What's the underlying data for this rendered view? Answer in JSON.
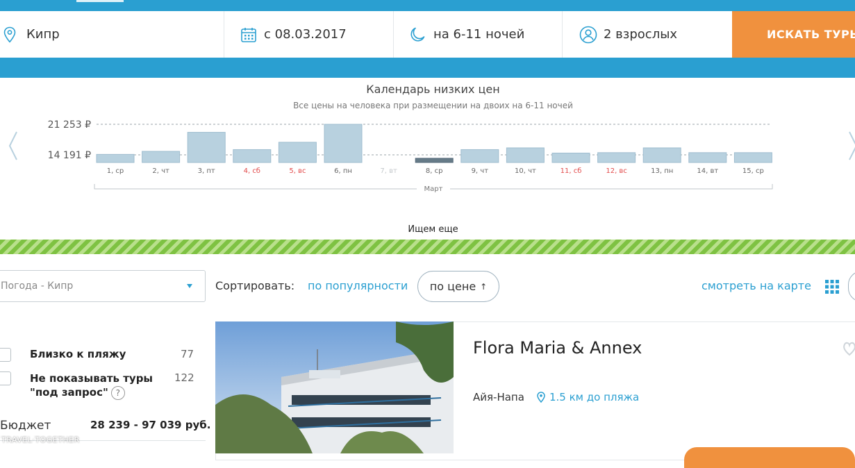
{
  "search": {
    "destination": "Кипр",
    "date": "с 08.03.2017",
    "nights": "на 6-11 ночей",
    "travelers": "2 взрослых",
    "button": "ИСКАТЬ ТУРЫ"
  },
  "calendar": {
    "title": "Календарь низких цен",
    "subtitle": "Все цены на человека при размещении на двоих на 6-11 ночей",
    "status": "Ищем еще"
  },
  "chart_data": {
    "type": "bar",
    "title": "Календарь низких цен",
    "y_ticks": [
      21253,
      14191
    ],
    "y_tick_labels": [
      "21 253 ₽",
      "14 191 ₽"
    ],
    "month": "Март",
    "categories": [
      "1, ср",
      "2, чт",
      "3, пт",
      "4, сб",
      "5, вс",
      "6, пн",
      "7, вт",
      "8, ср",
      "9, чт",
      "10, чт",
      "11, сб",
      "12, вс",
      "13, пн",
      "14, вт",
      "15, ср"
    ],
    "values": [
      14300,
      15000,
      19400,
      15400,
      17100,
      21253,
      null,
      13400,
      15400,
      15800,
      14600,
      14700,
      15800,
      14700,
      14700
    ],
    "weekend": [
      false,
      false,
      false,
      true,
      true,
      false,
      false,
      false,
      false,
      false,
      true,
      true,
      false,
      false,
      false
    ],
    "selected_index": 7,
    "unavailable_index": 6,
    "colors": {
      "bar": "#b8d1df",
      "selected": "#667b88",
      "weekend": "#e24a4a"
    }
  },
  "filters": {
    "weather": "Погода - Кипр",
    "sort_label": "Сортировать:",
    "sort_popularity": "по популярности",
    "sort_price": "по цене",
    "sort_price_arrow": "↑",
    "map_link": "смотреть на карте",
    "options": [
      {
        "label": "Близко к пляжу",
        "count": "77"
      },
      {
        "label": "Не показывать туры \"под запрос\"",
        "count": "122"
      }
    ],
    "budget_label": "Бюджет",
    "budget_value": "28 239 - 97 039 руб."
  },
  "hotel": {
    "name": "Flora Maria & Annex",
    "city": "Айя-Напа",
    "beach": "1.5 км до пляжа"
  },
  "watermark": "TRAVEL·TOGETHER"
}
